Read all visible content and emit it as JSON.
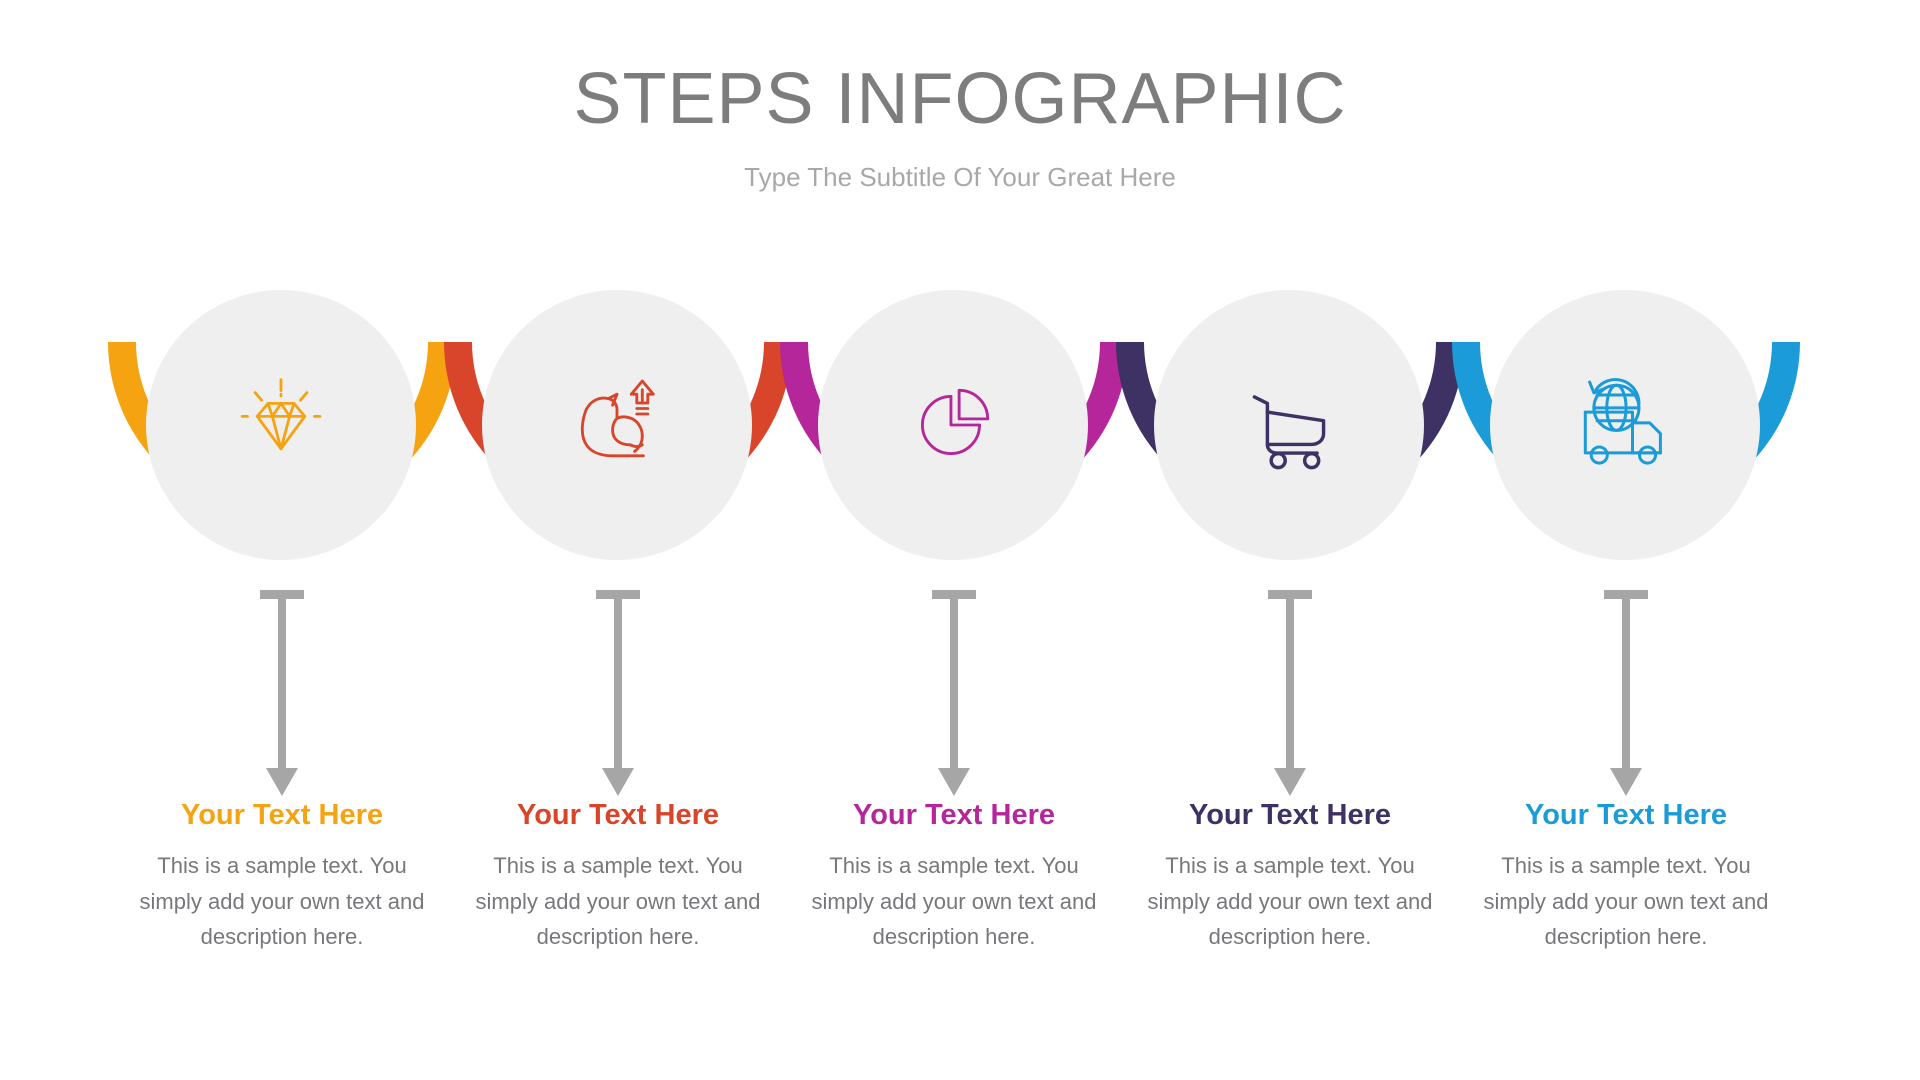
{
  "header": {
    "title": "STEPS INFOGRAPHIC",
    "subtitle": "Type The Subtitle Of Your Great Here",
    "title_color": "#7d7d7d",
    "subtitle_color": "#a8a8a8"
  },
  "theme": {
    "background": "#ffffff",
    "disc_color": "#efefef",
    "connector_color": "#a6a6a6",
    "body_text_color": "#77787b"
  },
  "steps": [
    {
      "id": "step-1",
      "icon": "diamond-icon",
      "color": "#f5a310",
      "heading": "Your Text Here",
      "body": "This is a sample text. You simply add your own text and description here."
    },
    {
      "id": "step-2",
      "icon": "flexed-bicep-icon",
      "color": "#d8452a",
      "heading": "Your Text Here",
      "body": "This is a sample text. You simply add your own text and description here."
    },
    {
      "id": "step-3",
      "icon": "pie-chart-icon",
      "color": "#b5269b",
      "heading": "Your Text Here",
      "body": "This is a sample text. You simply add your own text and description here."
    },
    {
      "id": "step-4",
      "icon": "shopping-cart-icon",
      "color": "#3e3163",
      "heading": "Your Text Here",
      "body": "This is a sample text. You simply add your own text and description here."
    },
    {
      "id": "step-5",
      "icon": "delivery-truck-globe-icon",
      "color": "#1b9bd8",
      "heading": "Your Text Here",
      "body": "This is a sample text. You simply add your own text and description here."
    }
  ]
}
